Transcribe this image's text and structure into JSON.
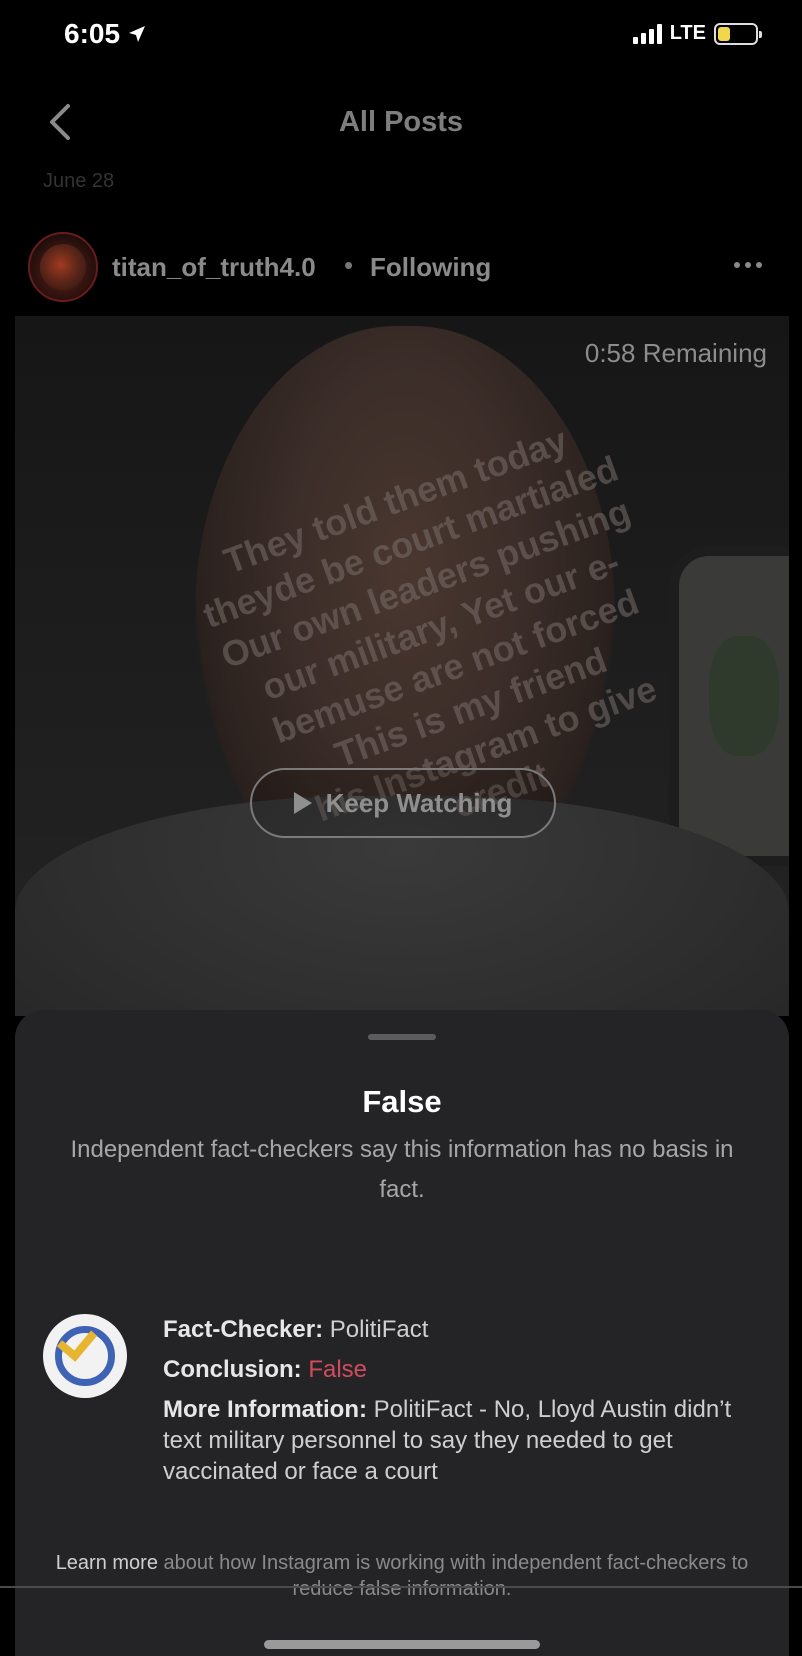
{
  "status_bar": {
    "time": "6:05",
    "network": "LTE",
    "location_icon": "location-arrow-icon",
    "signal_icon": "cellular-signal-icon",
    "battery_icon": "battery-icon",
    "battery_color": "#f2d64b"
  },
  "nav": {
    "title": "All Posts",
    "back_icon": "chevron-left-icon"
  },
  "post": {
    "date": "June 28",
    "username": "titan_of_truth4.0",
    "separator": "•",
    "following_label": "Following",
    "more_icon": "more-horizontal-icon"
  },
  "video": {
    "remaining": "0:58 Remaining",
    "keep_watching_label": "Keep Watching",
    "overlay_lines": [
      "They told them today",
      "theyde be court martialed",
      "Our own leaders pushing",
      "our military, Yet our e-",
      "bemuse are not forced",
      "This is my friend",
      "his Instagram to give",
      "credit"
    ]
  },
  "fact_check": {
    "title": "False",
    "description": "Independent fact-checkers say this information has no basis in fact.",
    "checker_label": "Fact-Checker:",
    "checker_value": "PolitiFact",
    "conclusion_label": "Conclusion:",
    "conclusion_value": "False",
    "more_info_label": "More Information:",
    "more_info_value": "PolitiFact - No, Lloyd Austin didn’t text military personnel to say they needed to get vaccinated or face a court",
    "learn_more_link": "Learn more",
    "learn_more_text": "about how Instagram is working with independent fact-checkers to reduce false information.",
    "accent_false_color": "#d24b5d",
    "politifact_icon": "politifact-logo-icon"
  }
}
